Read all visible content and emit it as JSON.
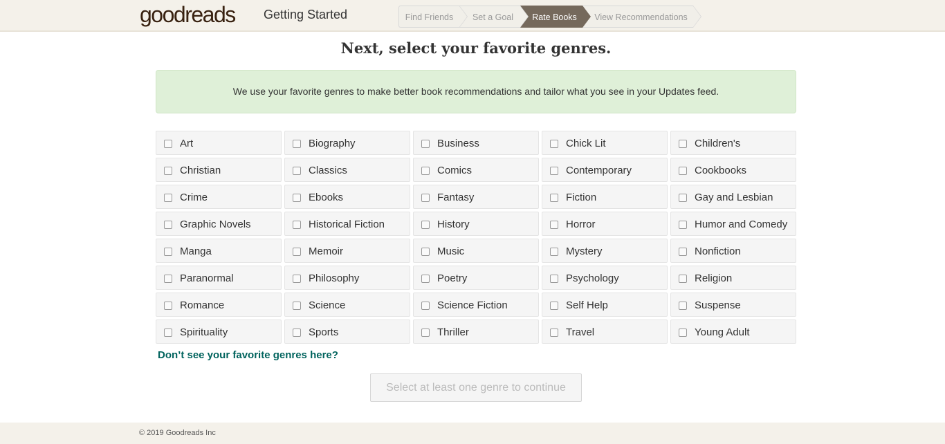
{
  "header": {
    "logo_text_light": "good",
    "logo_text_bold": "reads",
    "title": "Getting Started",
    "steps": [
      {
        "label": "Find Friends",
        "active": false
      },
      {
        "label": "Set a Goal",
        "active": false
      },
      {
        "label": "Rate Books",
        "active": true
      },
      {
        "label": "View Recommendations",
        "active": false
      }
    ]
  },
  "main": {
    "heading": "Next, select your favorite genres.",
    "notice": "We use your favorite genres to make better book recommendations and tailor what you see in your Updates feed.",
    "genres": [
      "Art",
      "Biography",
      "Business",
      "Chick Lit",
      "Children's",
      "Christian",
      "Classics",
      "Comics",
      "Contemporary",
      "Cookbooks",
      "Crime",
      "Ebooks",
      "Fantasy",
      "Fiction",
      "Gay and Lesbian",
      "Graphic Novels",
      "Historical Fiction",
      "History",
      "Horror",
      "Humor and Comedy",
      "Manga",
      "Memoir",
      "Music",
      "Mystery",
      "Nonfiction",
      "Paranormal",
      "Philosophy",
      "Poetry",
      "Psychology",
      "Religion",
      "Romance",
      "Science",
      "Science Fiction",
      "Self Help",
      "Suspense",
      "Spirituality",
      "Sports",
      "Thriller",
      "Travel",
      "Young Adult"
    ],
    "more_genres_link": "Don’t see your favorite genres here?",
    "continue_button": "Select at least one genre to continue"
  },
  "footer": {
    "copyright": "© 2019 Goodreads Inc"
  },
  "colors": {
    "header_bg": "#f4f1ea",
    "active_step": "#75695c",
    "notice_bg": "#dff0d8",
    "link": "#00635d"
  }
}
